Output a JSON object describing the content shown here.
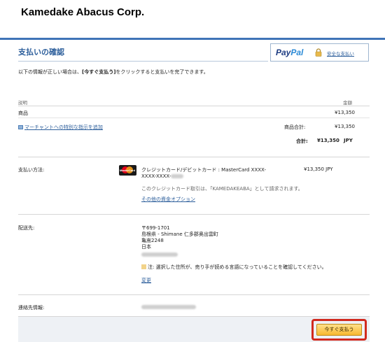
{
  "merchant_name": "Kamedake Abacus Corp.",
  "page_title": "支払いの確認",
  "paypal": {
    "logo_pay": "Pay",
    "logo_pal": "Pal",
    "secure_link": "安全な支払い"
  },
  "intro": {
    "before": "以下の情報が正しい場合は、",
    "button_ref": "[今すぐ支払う]",
    "after": "をクリックすると支払いを完了できます。"
  },
  "cart": {
    "header_desc": "説明",
    "header_amount": "金額",
    "item_name": "商品",
    "item_amount": "¥13,350",
    "note_link": "マーチャントへの特別な指示を追加",
    "subtotal_label": "商品合計:",
    "subtotal_amount": "¥13,350",
    "total_label": "合計:",
    "total_amount": "¥13,350",
    "total_currency": "JPY"
  },
  "payment": {
    "label": "支払い方法:",
    "card_icon_text": "MasterCard",
    "card_line1": "クレジットカード/デビットカード : MasterCard XXXX-",
    "card_line2": "XXXX-XXXX-",
    "card_amount": "¥13,350 JPY",
    "billing_note": "このクレジットカード取引は、「KAMEDAKEABA」として請求されます。",
    "other_options": "その他の資金オプション"
  },
  "shipping": {
    "label": "配送先:",
    "postal": "〒699-1701",
    "line1": "島根県 - Shimane 仁多郡奥出雲町",
    "line2": "亀嵩2248",
    "country": "日本",
    "note": "注: 選択した住所が、売り手が読める言語になっていることを確認してください。",
    "change_link": "変更"
  },
  "contact": {
    "label": "連絡先情報:"
  },
  "pay_now_button": "今すぐ支払う",
  "colors": {
    "brand_blue": "#3f74b7",
    "title_blue": "#2c5e9b",
    "button_gold": "#f8b930",
    "highlight_red": "#d12a1f"
  }
}
